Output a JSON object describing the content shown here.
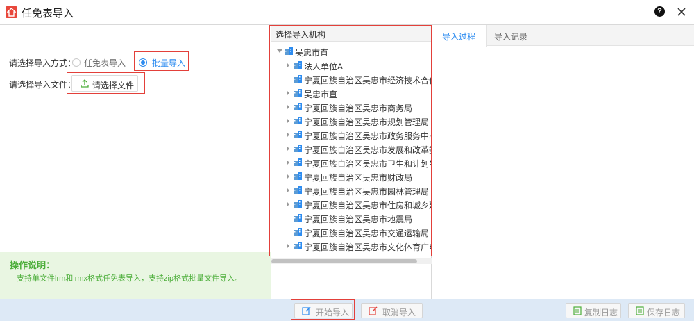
{
  "window": {
    "title": "任免表导入",
    "help_label": "?"
  },
  "import_form": {
    "mode_label": "请选择导入方式：",
    "mode_options": [
      {
        "label": "任免表导入",
        "selected": false
      },
      {
        "label": "批量导入",
        "selected": true
      }
    ],
    "file_label": "请选择导入文件：",
    "file_button": "请选择文件"
  },
  "notice": {
    "title": "操作说明：",
    "text": "支持单文件lrm和lrmx格式任免表导入，支持zip格式批量文件导入。"
  },
  "org_tree": {
    "header": "选择导入机构",
    "root": "吴忠市直",
    "items": [
      {
        "label": "法人单位A",
        "expandable": true
      },
      {
        "label": "宁夏回族自治区吴忠市经济技术合作局",
        "expandable": false
      },
      {
        "label": "吴忠市直",
        "expandable": true
      },
      {
        "label": "宁夏回族自治区吴忠市商务局",
        "expandable": true
      },
      {
        "label": "宁夏回族自治区吴忠市规划管理局",
        "expandable": true
      },
      {
        "label": "宁夏回族自治区吴忠市政务服务中心（",
        "expandable": true
      },
      {
        "label": "宁夏回族自治区吴忠市发展和改革委员",
        "expandable": true
      },
      {
        "label": "宁夏回族自治区吴忠市卫生和计划生育",
        "expandable": true
      },
      {
        "label": "宁夏回族自治区吴忠市财政局",
        "expandable": true
      },
      {
        "label": "宁夏回族自治区吴忠市园林管理局",
        "expandable": true
      },
      {
        "label": "宁夏回族自治区吴忠市住房和城乡建设",
        "expandable": true
      },
      {
        "label": "宁夏回族自治区吴忠市地震局",
        "expandable": false
      },
      {
        "label": "宁夏回族自治区吴忠市交通运输局",
        "expandable": false
      },
      {
        "label": "宁夏回族自治区吴忠市文化体育广电",
        "expandable": true
      }
    ]
  },
  "tabs": [
    {
      "label": "导入过程",
      "active": true
    },
    {
      "label": "导入记录",
      "active": false
    }
  ],
  "footer": {
    "start": "开始导入",
    "cancel": "取消导入",
    "copy_log": "复制日志",
    "save_log": "保存日志"
  },
  "colors": {
    "accent": "#2d8cf0",
    "highlight_border": "#e3403a",
    "notice_bg": "#e9f6e2",
    "notice_text": "#4cae3a",
    "footer_bg": "#dde9f6"
  }
}
